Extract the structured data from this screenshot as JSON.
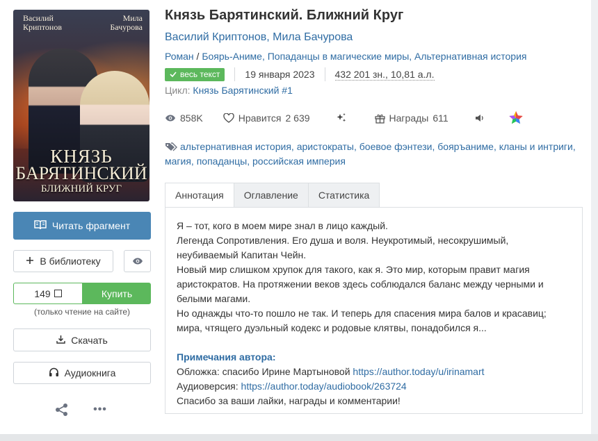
{
  "cover": {
    "author_left_1": "Василий",
    "author_left_2": "Криптонов",
    "author_right_1": "Мила",
    "author_right_2": "Бачурова",
    "title_line1": "КНЯЗЬ",
    "title_line2": "БАРЯТИНСКИЙ",
    "title_line3": "БЛИЖНИЙ КРУГ"
  },
  "actions": {
    "read_label": "Читать фрагмент",
    "library_label": "В библиотеку",
    "price": "149",
    "buy_label": "Купить",
    "price_note": "(только чтение на сайте)",
    "download_label": "Скачать",
    "audiobook_label": "Аудиокнига",
    "more_label": "•••"
  },
  "book": {
    "title": "Князь Барятинский. Ближний Круг",
    "authors": [
      "Василий Криптонов",
      "Мила Бачурова"
    ],
    "genres": [
      "Роман",
      "Боярь-Аниме",
      "Попаданцы в магические миры",
      "Альтернативная история"
    ],
    "status_badge": "весь текст",
    "date": "19 января 2023",
    "size": "432 201 зн., 10,81 а.л.",
    "cycle_label": "Цикл:",
    "cycle_value": "Князь Барятинский #1"
  },
  "stats": {
    "views": "858K",
    "likes_label": "Нравится",
    "likes": "2 639",
    "awards_label": "Награды",
    "awards": "611"
  },
  "tags": [
    "альтернативная история",
    "аристократы",
    "боевое фэнтези",
    "бояръаниме",
    "кланы и интриги",
    "магия",
    "попаданцы",
    "российская империя"
  ],
  "tabs": [
    "Аннотация",
    "Оглавление",
    "Статистика"
  ],
  "annotation": {
    "lines": [
      "Я – тот, кого в моем мире знал в лицо каждый.",
      "Легенда Сопротивления. Его душа и воля. Неукротимый, несокрушимый, неубиваемый Капитан Чейн.",
      "Новый мир слишком хрупок для такого, как я. Это мир, которым правит магия аристократов. На протяжении веков здесь соблюдался баланс между черными и белыми магами.",
      "Но однажды что-то пошло не так. И теперь для спасения мира балов и красавиц; мира, чтящего дуэльный кодекс и родовые клятвы, понадобился я..."
    ],
    "notes_title": "Примечания автора:",
    "cover_note_label": "Обложка: спасибо Ирине Мартыновой",
    "cover_note_link": "https://author.today/u/irinamart",
    "audio_note_label": "Аудиоверсия:",
    "audio_note_link": "https://author.today/audiobook/263724",
    "thanks": "Спасибо за ваши лайки, награды и комментарии!"
  },
  "colors": {
    "accent": "#4a86b5",
    "link": "#2f6ca3",
    "buy": "#5cb85c"
  }
}
